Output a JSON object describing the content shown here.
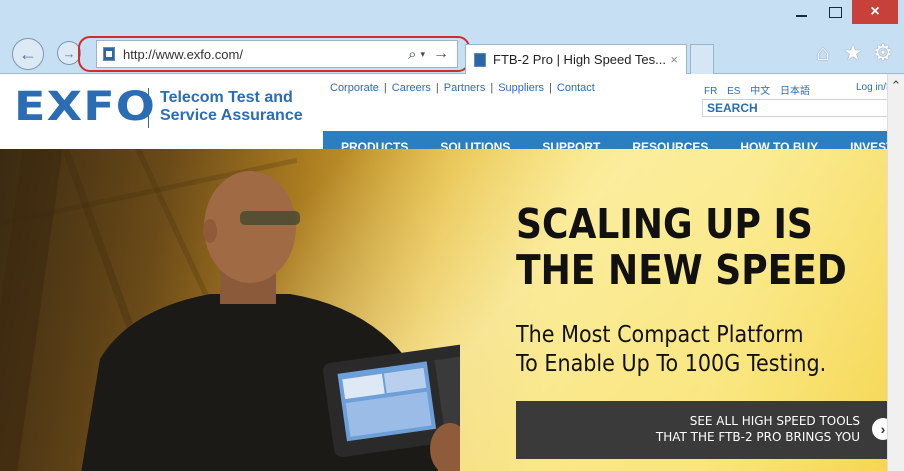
{
  "browser": {
    "address_host": "http://www.exfo.com/",
    "tab_title": "FTB-2 Pro | High Speed Tes...",
    "tab_close": "×",
    "back_glyph": "←",
    "forward_glyph": "→",
    "search_glyph": "⌕",
    "dropdown_glyph": "▾",
    "go_glyph": "→",
    "home_icon": "home-icon",
    "favorites_icon": "star-icon",
    "tools_icon": "gear-icon",
    "close_glyph": "×",
    "highlight_color": "#d42a2a"
  },
  "header": {
    "logo": "EXFO",
    "tagline_line1": "Telecom Test and",
    "tagline_line2": "Service Assurance",
    "links": [
      "Corporate",
      "Careers",
      "Partners",
      "Suppliers",
      "Contact"
    ],
    "languages": [
      "FR",
      "ES",
      "中文",
      "日本語"
    ],
    "login": "Log in/F",
    "search_placeholder": "SEARCH"
  },
  "nav": [
    "PRODUCTS",
    "SOLUTIONS",
    "SUPPORT",
    "RESOURCES",
    "HOW TO BUY",
    "INVESTO"
  ],
  "hero": {
    "headline_line1": "SCALING UP IS",
    "headline_line2": "THE NEW SPEED",
    "sub_line1": "The Most Compact Platform",
    "sub_line2": "To Enable Up To 100G Testing.",
    "cta_line1": "SEE ALL HIGH SPEED TOOLS",
    "cta_line2": "THAT THE FTB-2 PRO BRINGS YOU",
    "cta_arrow": "›"
  },
  "colors": {
    "brand_blue": "#2a6db5",
    "nav_blue": "#2a7fc1",
    "chrome_blue": "#c7dff3"
  }
}
